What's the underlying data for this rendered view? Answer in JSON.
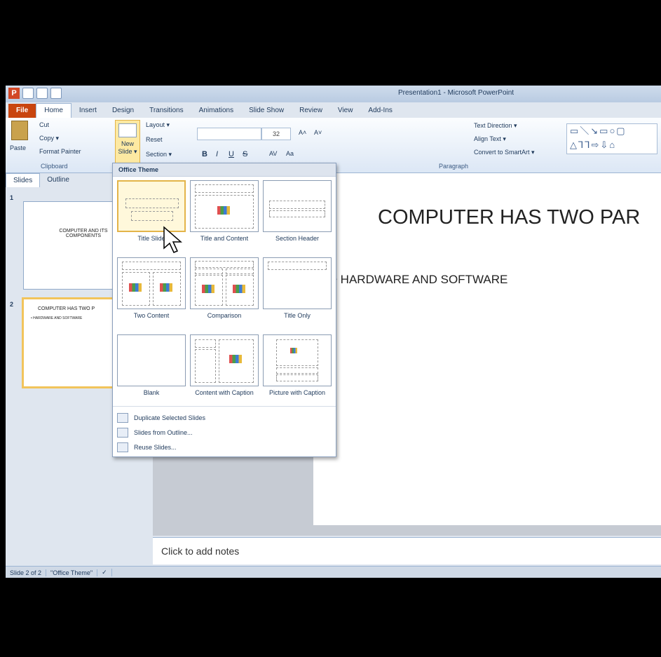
{
  "window": {
    "title": "Presentation1 - Microsoft PowerPoint"
  },
  "ribbon_tabs": [
    "File",
    "Home",
    "Insert",
    "Design",
    "Transitions",
    "Animations",
    "Slide Show",
    "Review",
    "View",
    "Add-Ins"
  ],
  "clipboard": {
    "paste": "Paste",
    "cut": "Cut",
    "copy": "Copy ▾",
    "format_painter": "Format Painter",
    "group_label": "Clipboard"
  },
  "slides_group": {
    "new_slide": "New Slide ▾",
    "layout": "Layout ▾",
    "reset": "Reset",
    "section": "Section ▾"
  },
  "font": {
    "size": "32",
    "bold": "B",
    "italic": "I",
    "underline": "U",
    "strike": "S",
    "grow": "A˄",
    "shrink": "A˅",
    "case": "Aa",
    "spacing": "AV"
  },
  "paragraph": {
    "text_direction": "Text Direction ▾",
    "align_text": "Align Text ▾",
    "convert_smartart": "Convert to SmartArt ▾",
    "group_label": "Paragraph"
  },
  "panel_tabs": [
    "Slides",
    "Outline"
  ],
  "thumbnails": [
    {
      "num": "1",
      "text": "COMPUTER AND ITS COMPONENTS"
    },
    {
      "num": "2",
      "text": "COMPUTER HAS TWO P",
      "bullet": "• HARDWARE AND SOFTWARE"
    }
  ],
  "slide": {
    "title": "COMPUTER HAS TWO PAR",
    "bullet": "• HARDWARE AND SOFTWARE"
  },
  "notes_placeholder": "Click to add notes",
  "status": {
    "slide": "Slide 2 of 2",
    "theme": "\"Office Theme\""
  },
  "dropdown": {
    "header": "Office Theme",
    "layouts": [
      "Title Slide",
      "Title and Content",
      "Section Header",
      "Two Content",
      "Comparison",
      "Title Only",
      "Blank",
      "Content with Caption",
      "Picture with Caption"
    ],
    "menu": [
      "Duplicate Selected Slides",
      "Slides from Outline...",
      "Reuse Slides..."
    ]
  },
  "colors": {
    "file_tab": "#c9450f",
    "selection": "#f2c45b",
    "ribbon": "#dce7f5"
  }
}
